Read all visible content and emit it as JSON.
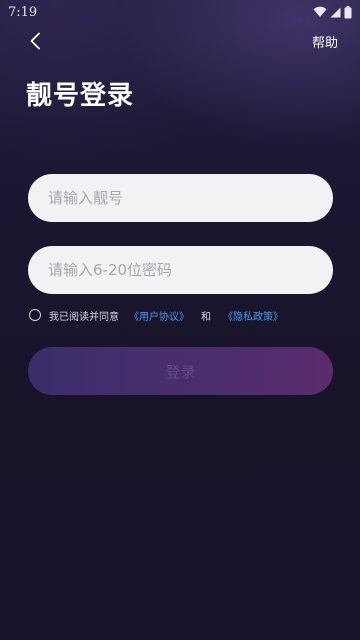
{
  "status_bar": {
    "time": "7:19"
  },
  "header": {
    "back_icon": "chevron-left-icon",
    "help_label": "帮助"
  },
  "title": "靓号登录",
  "form": {
    "account_placeholder": "请输入靓号",
    "password_placeholder": "请输入6-20位密码"
  },
  "agreement": {
    "text": "我已阅读并同意",
    "user_agreement": "《用户协议》",
    "and": "和",
    "privacy_policy": "《隐私政策》"
  },
  "login_button": "登录",
  "colors": {
    "background": "#17142a",
    "link": "#4a9af0",
    "button_gradient_start": "#3a2d6a",
    "button_gradient_end": "#5b2c6c",
    "input_bg": "#f2f2f4"
  }
}
